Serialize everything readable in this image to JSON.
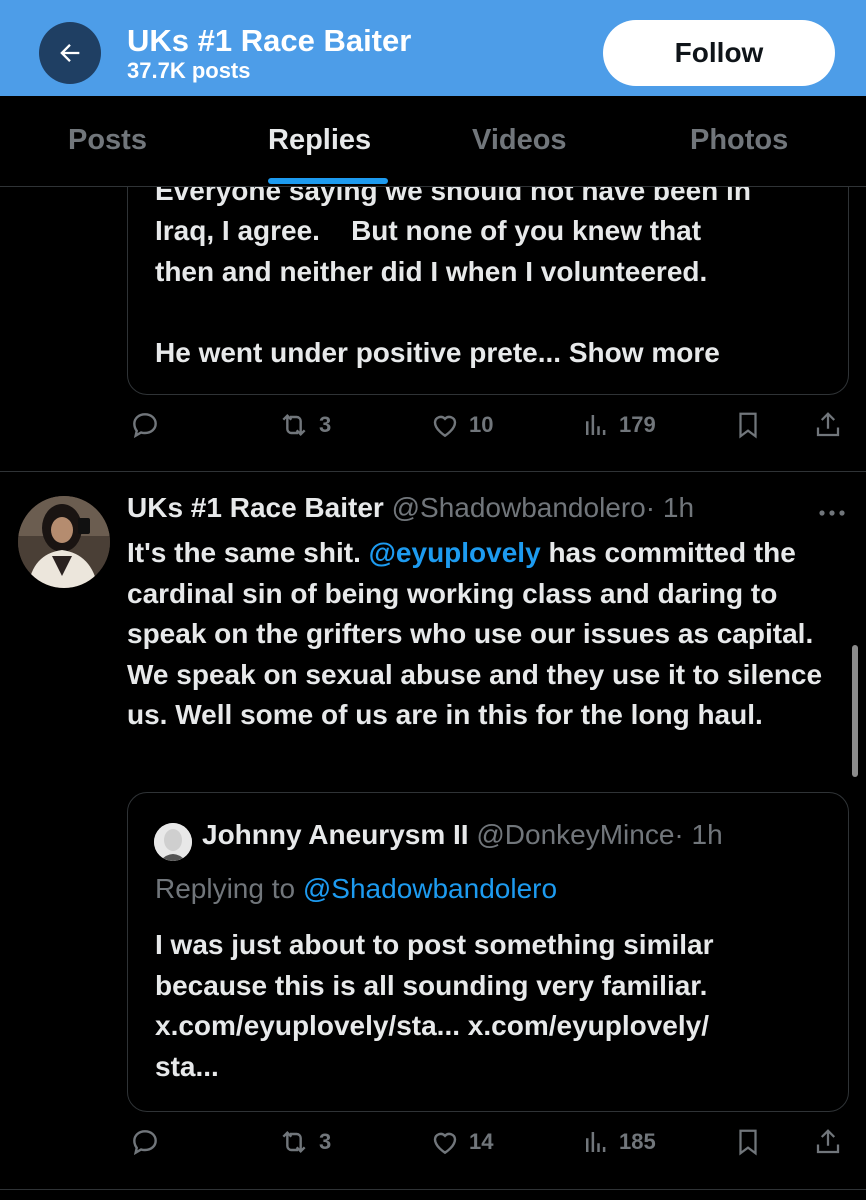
{
  "header": {
    "back_label": "Back",
    "title": "UKs #1 Race Baiter",
    "post_count": "37.7K posts",
    "follow_label": "Follow",
    "background": "#4d9de8"
  },
  "tabs": [
    {
      "label": "Posts"
    },
    {
      "label": "Replies",
      "active": true
    },
    {
      "label": "Videos"
    },
    {
      "label": "Photos"
    }
  ],
  "accent_color": "#1d9bf0",
  "post1": {
    "quote_text_partial": "Everyone saying we should not have been in",
    "quote_text_1": "Iraq, I agree.    But none of you knew that",
    "quote_text_2": "then and neither did I when I volunteered.",
    "quote_text_3": "He went under positive prete...",
    "show_more": "Show more",
    "actions": {
      "reply_icon": "reply-icon",
      "reposts": "3",
      "likes": "10",
      "views": "179"
    }
  },
  "post2": {
    "author_name": "UKs #1 Race Baiter",
    "author_handle": "@Shadowbandolero",
    "time": "· 1h",
    "text_before_mention": "It's the same shit. ",
    "mention": "@eyuplovely",
    "text_after_mention": " has committed the cardinal sin of being working class and daring to speak on the grifters who use our issues as capital. We speak on sexual abuse and they use it to silence us. Well some of us are in this for the long haul.",
    "quote": {
      "author_name": "Johnny Aneurysm II",
      "author_handle": "@DonkeyMince",
      "time": "· 1h",
      "replying_label": "Replying to",
      "replying_handle": "@Shadowbandolero",
      "text_line_1": "I was just about to post something similar",
      "text_line_2": "because this is all sounding very familiar.",
      "text_line_3": "x.com/eyuplovely/sta... x.com/eyuplovely/",
      "text_line_4": "sta..."
    },
    "actions": {
      "reposts": "3",
      "likes": "14",
      "views": "185"
    }
  }
}
